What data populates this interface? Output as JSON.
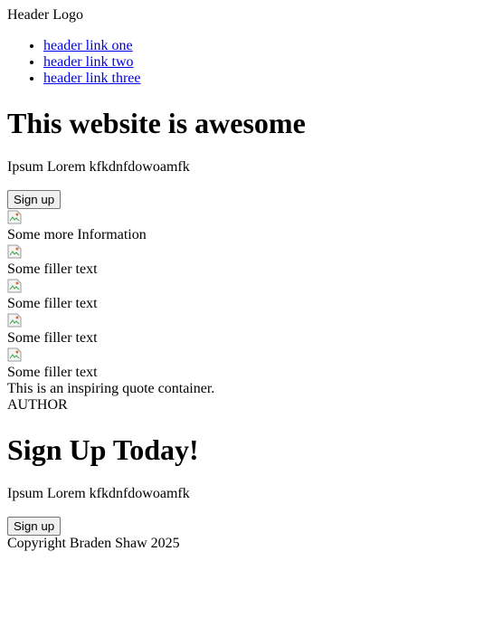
{
  "header": {
    "logo": "Header Logo",
    "links": [
      "header link one",
      "header link two",
      "header link three"
    ]
  },
  "hero": {
    "title": "This website is awesome",
    "text": "Ipsum Lorem kfkdnfdowoamfk",
    "button_label": "Sign up"
  },
  "info": {
    "heading": "Some more Information",
    "items": [
      "Some filler text",
      "Some filler text",
      "Some filler text",
      "Some filler text"
    ]
  },
  "quote": {
    "text": "This is an inspiring quote container.",
    "author": "AUTHOR"
  },
  "signup": {
    "title": "Sign Up Today!",
    "text": "Ipsum Lorem kfkdnfdowoamfk",
    "button_label": "Sign up"
  },
  "footer": {
    "copyright": "Copyright Braden Shaw 2025"
  }
}
